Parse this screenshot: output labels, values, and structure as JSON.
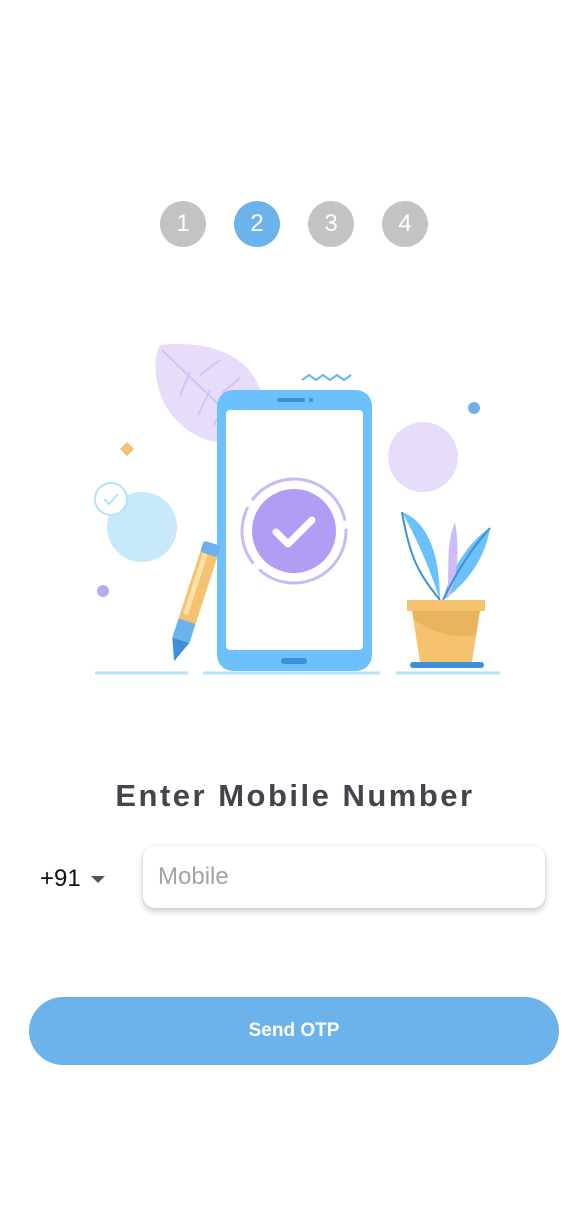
{
  "stepper": {
    "steps": [
      "1",
      "2",
      "3",
      "4"
    ],
    "active_step": "2",
    "active_color": "#6cb3ec",
    "inactive_color": "#c3c3c3"
  },
  "form": {
    "title": "Enter Mobile Number",
    "country_code": "+91",
    "mobile_value": "",
    "mobile_placeholder": "Mobile",
    "submit_label": "Send OTP",
    "accent_color": "#6cb3ec"
  },
  "illustration": {
    "icon": "phone-verified-icon"
  }
}
